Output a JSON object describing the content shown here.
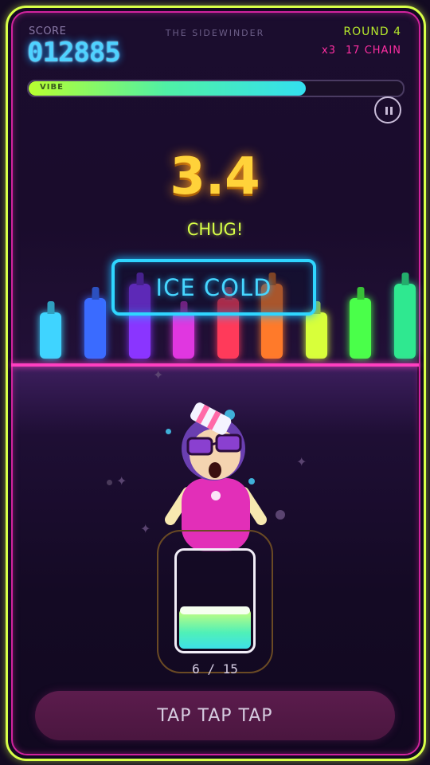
{
  "hud": {
    "score_label": "SCORE",
    "score": "012885",
    "venue": "THE SIDEWINDER",
    "round": "ROUND 4",
    "multiplier": "x3",
    "chain": "17 CHAIN",
    "vibe_label": "VIBE",
    "vibe_level": 0.74
  },
  "timer": "3.4",
  "prompt": "CHUG!",
  "sign": "ICE COLD",
  "bottles": [
    {
      "color": "#3fd4ff"
    },
    {
      "color": "#3a6bff"
    },
    {
      "color": "#8a35ff"
    },
    {
      "color": "#e037e0"
    },
    {
      "color": "#ff3a5a"
    },
    {
      "color": "#ff7a2a"
    },
    {
      "color": "#d8ff3a"
    },
    {
      "color": "#4aff4a"
    },
    {
      "color": "#2fe890"
    }
  ],
  "glass": {
    "progress_text": "6 / 15",
    "fill_level": 0.4
  },
  "tap_button": "TAP TAP TAP",
  "colors": {
    "frame_outer": "#d8ff48",
    "frame_inner": "#d1239e",
    "score": "#4fd2ff",
    "timer": "#ffd23a",
    "sign": "#2fd6ff"
  }
}
